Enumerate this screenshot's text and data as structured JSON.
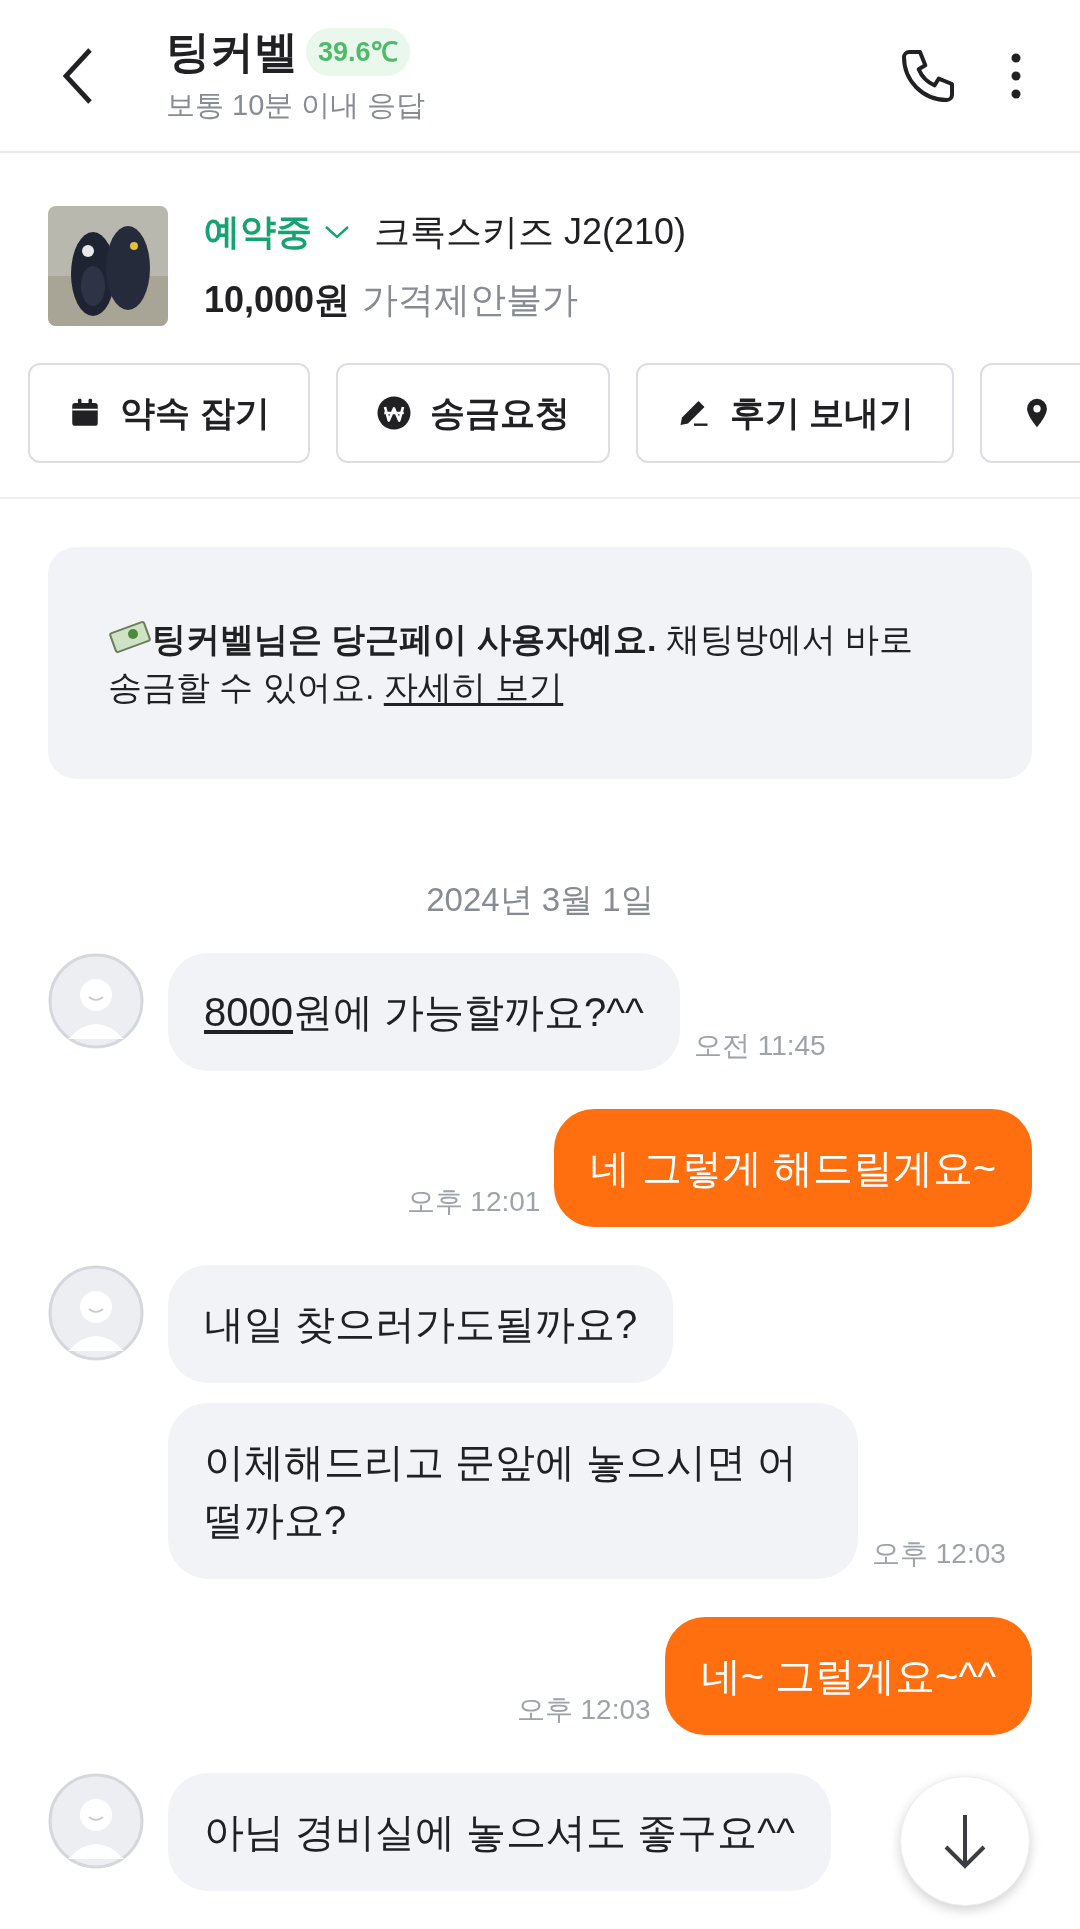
{
  "header": {
    "name": "팅커벨",
    "temperature": "39.6℃",
    "response_time": "보통 10분 이내 응답"
  },
  "product": {
    "status": "예약중",
    "title": "크록스키즈 J2(210)",
    "price": "10,000원",
    "price_note": "가격제안불가"
  },
  "actions": [
    {
      "kind": "calendar",
      "label": "약속 잡기"
    },
    {
      "kind": "won",
      "label": "송금요청"
    },
    {
      "kind": "pencil",
      "label": "후기 보내기"
    },
    {
      "kind": "location"
    }
  ],
  "notice": {
    "text": "**팅커벨님은 당근페이 사용자예요.** 채팅방에서 바로 송금할 수 있어요.",
    "link": "자세히 보기"
  },
  "date": "2024년 3월 1일",
  "messages": [
    {
      "kind": "received",
      "show_avatar": true,
      "parts": [
        {
          "text": "8000",
          "underlined": true
        },
        {
          "text": "원에 가능할까요?^^",
          "underlined": false
        }
      ],
      "time": "오전 11:45"
    },
    {
      "kind": "sent",
      "parts": [
        {
          "text": "네 그렇게 해드릴게요~",
          "underlined": false
        }
      ],
      "time": "오후 12:01"
    },
    {
      "kind": "received",
      "show_avatar": true,
      "parts": [
        {
          "text": "내일 찾으러가도될까요?",
          "underlined": false
        }
      ]
    },
    {
      "kind": "received",
      "show_avatar": false,
      "parts": [
        {
          "text": "이체해드리고 문앞에 놓으시면 어떨까요?",
          "underlined": false
        }
      ],
      "time": "오후 12:03"
    },
    {
      "kind": "sent",
      "parts": [
        {
          "text": "네~ 그럴게요~^^",
          "underlined": false
        }
      ],
      "time": "오후 12:03"
    },
    {
      "kind": "received",
      "show_avatar": true,
      "parts": [
        {
          "text": "아님 경비실에 놓으셔도 좋구요^^",
          "underlined": false
        }
      ]
    }
  ]
}
